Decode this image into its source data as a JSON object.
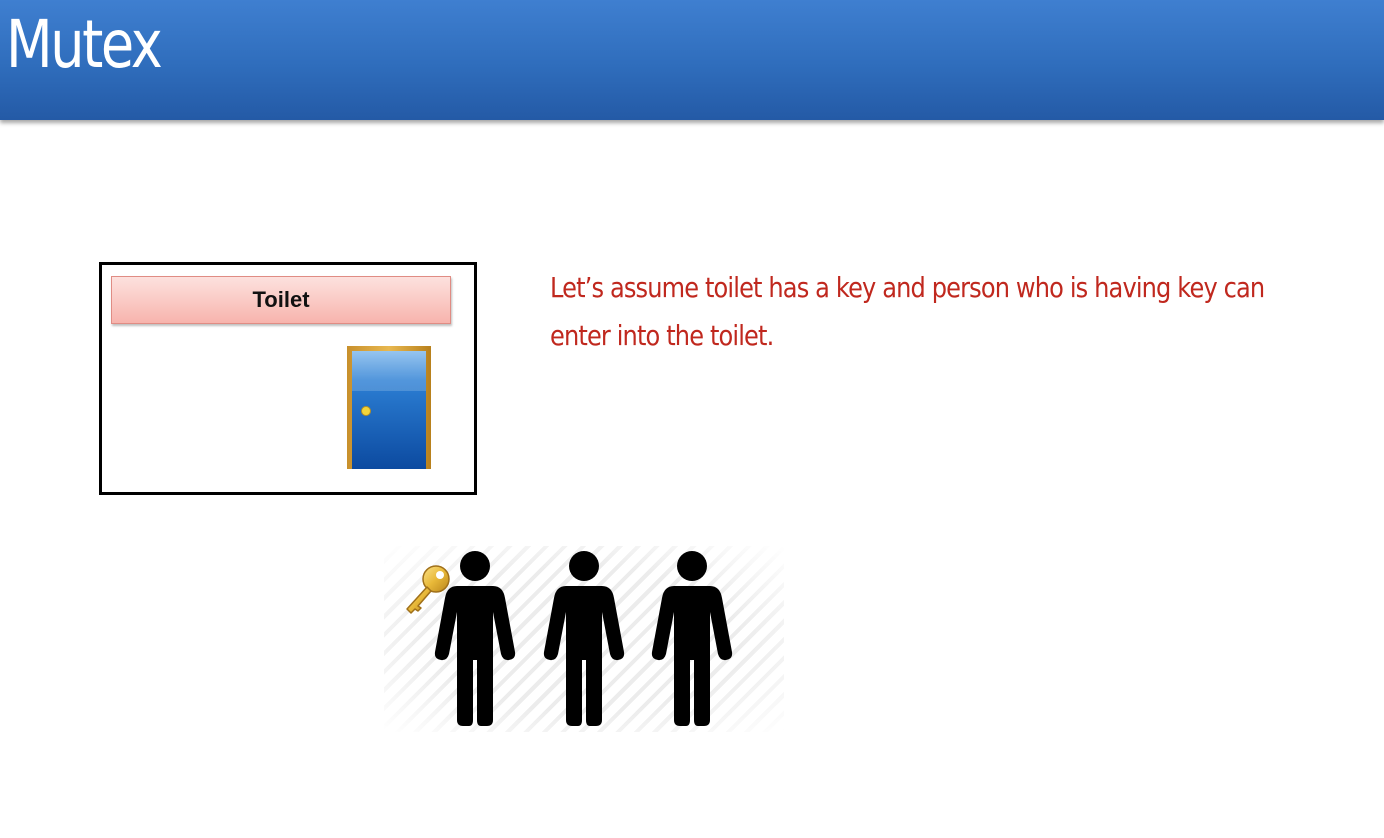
{
  "slide": {
    "title": "Mutex",
    "toilet_label": "Toilet",
    "description_lines": [
      "Let’s assume toilet has a key and person who is having key can",
      "enter into the toilet."
    ]
  },
  "icons": {
    "door": "door-icon",
    "key": "key-icon",
    "person": "person-icon"
  },
  "people": [
    {
      "has_key": true
    },
    {
      "has_key": false
    },
    {
      "has_key": false
    }
  ],
  "colors": {
    "title_bar": "#2f6dbc",
    "title_text": "#ffffff",
    "description_text": "#c0281e",
    "toilet_label_fill": "#f7b4ad",
    "door": "#1565c0",
    "door_frame": "#d4a040",
    "key": "#e0b030",
    "person": "#000000"
  }
}
